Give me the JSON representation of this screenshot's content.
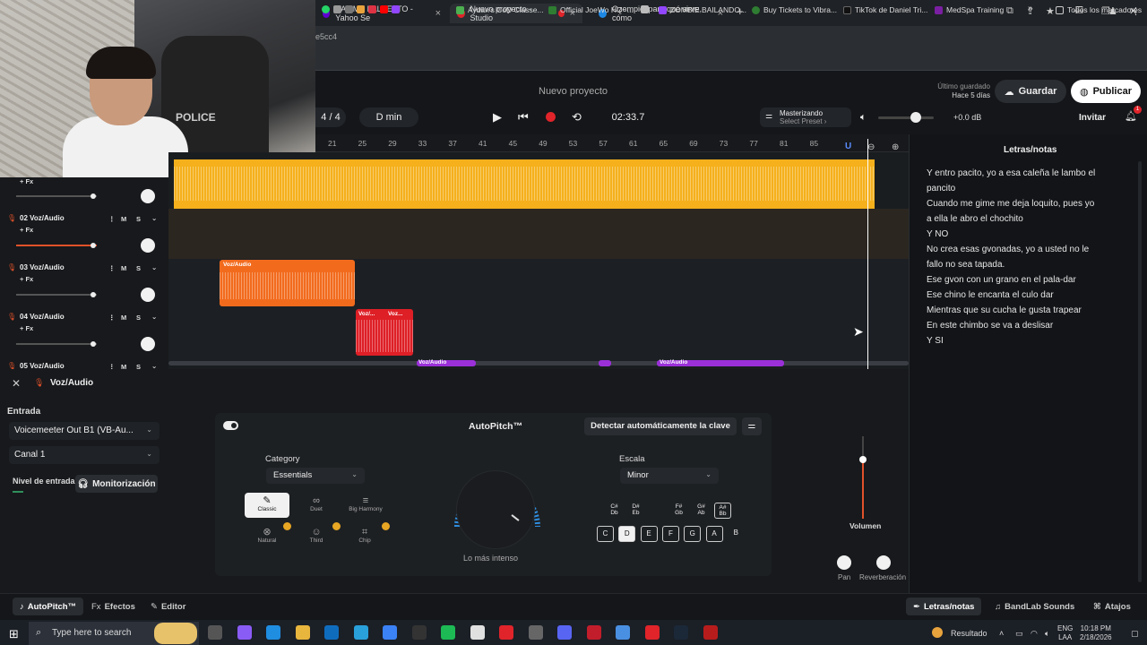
{
  "browser": {
    "tabs": [
      {
        "title": "SAMMY FALSETTO - Yahoo Se"
      },
      {
        "title": "Nuevo proyecto - Studio"
      },
      {
        "title": "Ozempic: para qué sirve, cómo"
      }
    ],
    "new_tab": "+",
    "url_fragment": "e5cc4",
    "bookmarks": [
      "Aydan's CoD Classe...",
      "Official JoeWo HQ -...",
      "ZOMBIE BAILANDO...",
      "Buy Tickets to Vibra...",
      "TikTok de Daniel Tri...",
      "MedSpa Training"
    ],
    "bookmarks_more": "»",
    "all_bookmarks": "Todos los marcadores"
  },
  "webcam": {
    "chair_text": "POLICE"
  },
  "header": {
    "project_name": "Nuevo proyecto",
    "last_saved_label": "Último guardado",
    "last_saved_time": "Hace 5 días",
    "save_label": "Guardar",
    "publish_label": "Publicar",
    "time_signature": "4 / 4",
    "key": "D min",
    "time": "02:33.7",
    "mastering_title": "Masterizando",
    "mastering_sub": "Select Preset ›",
    "volume_db": "+0.0 dB",
    "volume_level": 0.7,
    "invite_label": "Invitar",
    "notif_count": "1"
  },
  "ruler": {
    "ticks": [
      "21",
      "25",
      "29",
      "33",
      "37",
      "41",
      "45",
      "49",
      "53",
      "57",
      "61",
      "65",
      "69",
      "73",
      "77",
      "81",
      "85"
    ]
  },
  "tracks": [
    {
      "name": "02 Voz/Audio",
      "fx": "+ Fx",
      "m": "M",
      "s": "S"
    },
    {
      "name": "03 Voz/Audio",
      "fx": "+ Fx",
      "m": "M",
      "s": "S"
    },
    {
      "name": "04 Voz/Audio",
      "fx": "+ Fx",
      "m": "M",
      "s": "S"
    },
    {
      "name": "05 Voz/Audio",
      "fx": "",
      "m": "M",
      "s": "S"
    }
  ],
  "top_track_fx": "+ Fx",
  "clips": {
    "orange_label": "Voz/Audio",
    "red_label_a": "Voz/...",
    "red_label_b": "Voz...",
    "purple_label_a": "Voz/Audio",
    "purple_label_b": "Voz/Audio"
  },
  "lyrics": {
    "title": "Letras/notas",
    "lines": [
      "Y entro pacito, yo a esa caleña le lambo el",
      "pancito",
      "Cuando me gime me deja loquito, pues yo",
      "a ella le abro el chochito",
      "Y NO",
      "No crea esas gvonadas, yo a usted no le",
      "fallo no sea tapada.",
      "Ese gvon con un grano en el pala-dar",
      "Ese chino le encanta el culo dar",
      "Mientras que su cucha le gusta trapear",
      "En este chimbo se va a deslisar",
      "Y SI"
    ]
  },
  "bottom": {
    "track_name": "Voz/Audio",
    "entrada_label": "Entrada",
    "input_device": "Voicemeeter Out B1 (VB-Au...",
    "channel": "Canal 1",
    "nivel_label": "Nivel de entrada",
    "monitor_label": "Monitorización",
    "autopitch_title": "AutoPitch™",
    "detect_label": "Detectar automáticamente la clave",
    "category_label": "Category",
    "category_value": "Essentials",
    "scale_label": "Escala",
    "scale_value": "Minor",
    "presets": [
      "Classic",
      "Duet",
      "Big Harmony",
      "Natural",
      "Third",
      "Chip"
    ],
    "dial_label": "Lo más intenso",
    "sharps": [
      {
        "top": "C#",
        "bottom": "Db"
      },
      {
        "top": "D#",
        "bottom": "Eb"
      },
      {
        "top": "F#",
        "bottom": "Gb"
      },
      {
        "top": "G#",
        "bottom": "Ab"
      },
      {
        "top": "A#",
        "bottom": "Bb"
      }
    ],
    "keys": [
      "C",
      "D",
      "E",
      "F",
      "G",
      "A",
      "B"
    ],
    "volume_label": "Volumen",
    "pan_label": "Pan",
    "reverb_label": "Reverberación"
  },
  "bottom_tabs": {
    "autopitch": "AutoPitch™",
    "efectos": "Efectos",
    "editor": "Editor",
    "lyrics": "Letras/notas",
    "sounds": "BandLab Sounds",
    "shortcuts": "Atajos"
  },
  "taskbar": {
    "search_placeholder": "Type here to search",
    "weather": "Resultado",
    "lang": "ENG",
    "region": "LAA",
    "time": "10:18 PM",
    "date": "2/18/2026"
  },
  "colors": {
    "yellow_clip": "#f5b01c",
    "orange_clip": "#f26b1d",
    "red_clip": "#de1f26",
    "purple_clip": "#9b30d9",
    "accent_red": "#e0522a"
  }
}
